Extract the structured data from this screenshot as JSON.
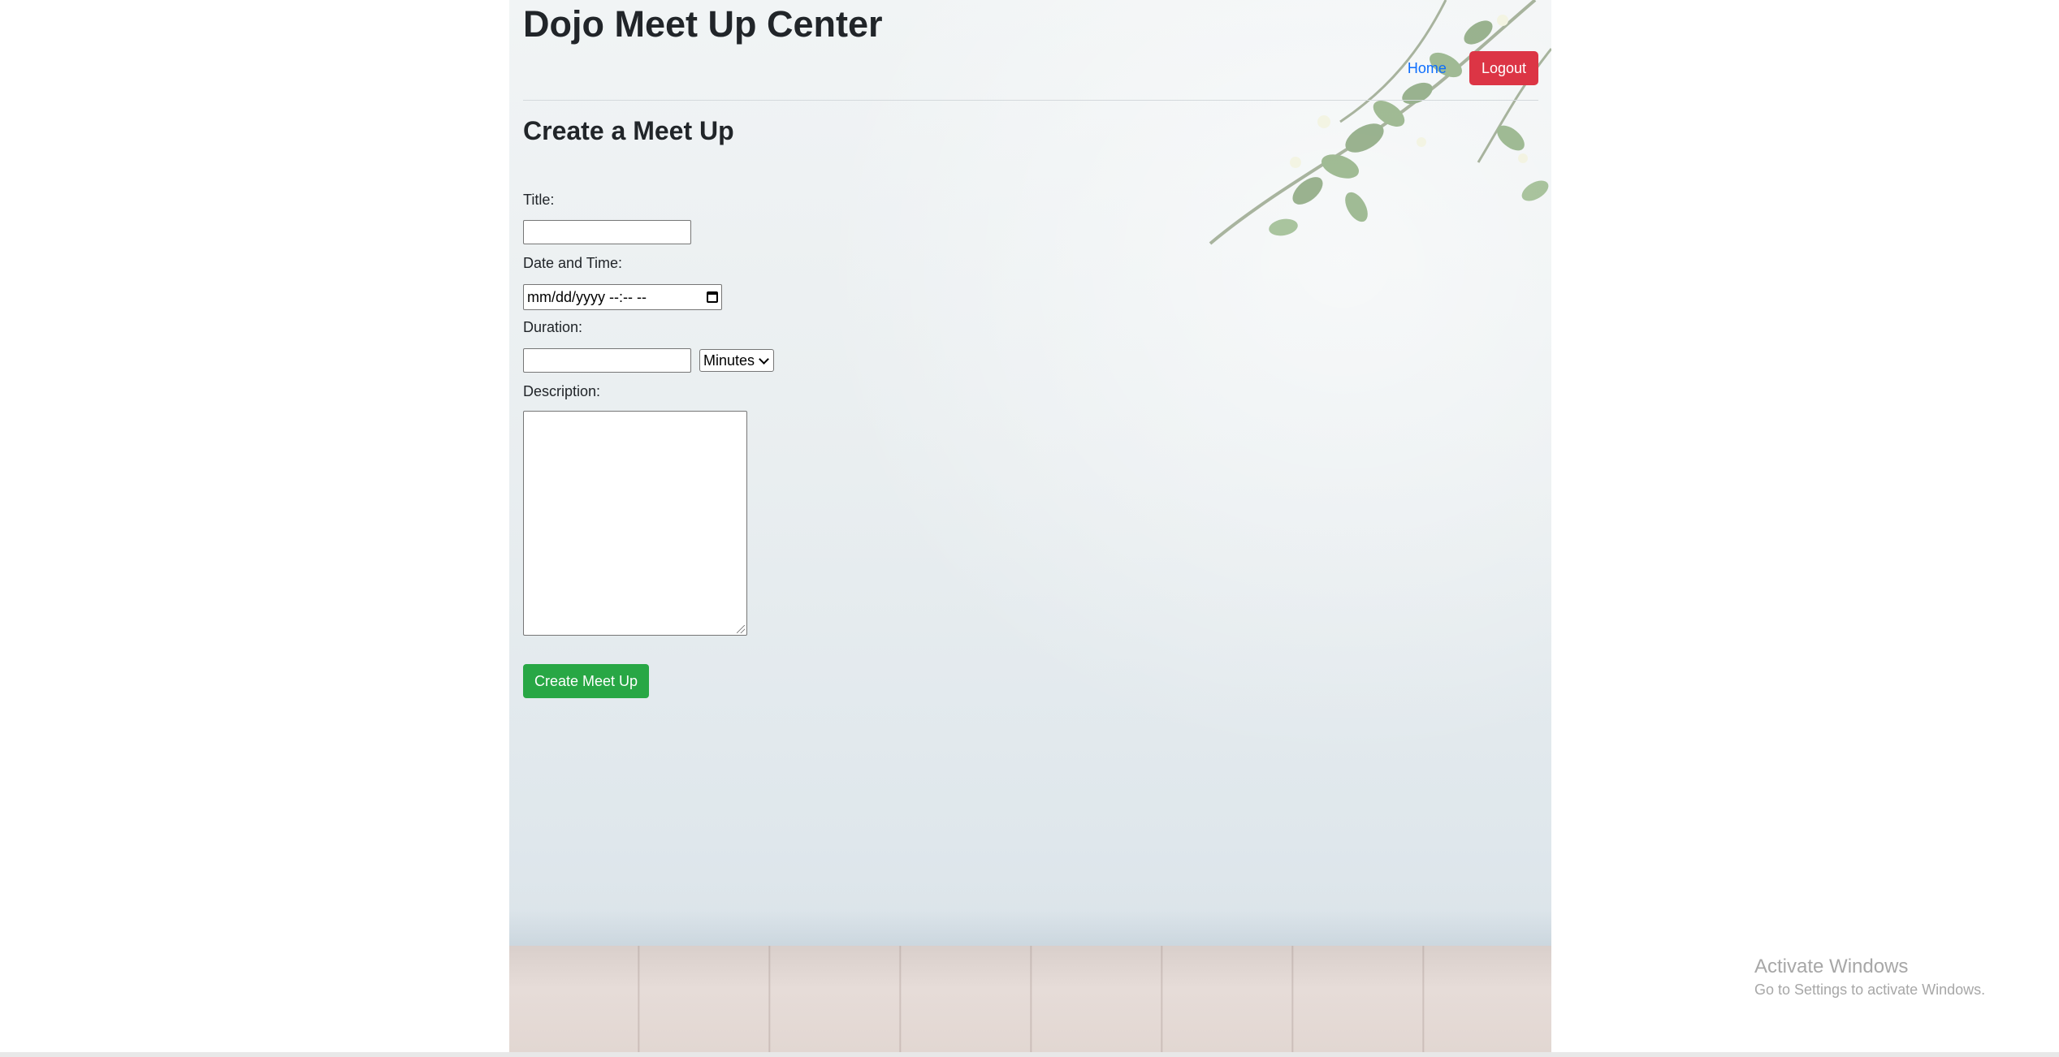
{
  "header": {
    "site_title": "Dojo Meet Up Center",
    "nav": {
      "home_label": "Home",
      "logout_label": "Logout"
    }
  },
  "form": {
    "heading": "Create a Meet Up",
    "title_label": "Title:",
    "title_value": "",
    "datetime_label": "Date and Time:",
    "datetime_placeholder": "mm/dd/yyyy --:-- --",
    "duration_label": "Duration:",
    "duration_value": "",
    "duration_unit_selected": "Minutes",
    "description_label": "Description:",
    "description_value": "",
    "submit_label": "Create Meet Up"
  },
  "os_watermark": {
    "title": "Activate Windows",
    "subtitle": "Go to Settings to activate Windows."
  },
  "colors": {
    "logout_button": "#dc3545",
    "submit_button": "#28a745",
    "link": "#0d6efd"
  },
  "icons": [
    "calendar-icon",
    "chevron-down-icon",
    "resize-grip-icon",
    "leaf-decoration"
  ]
}
